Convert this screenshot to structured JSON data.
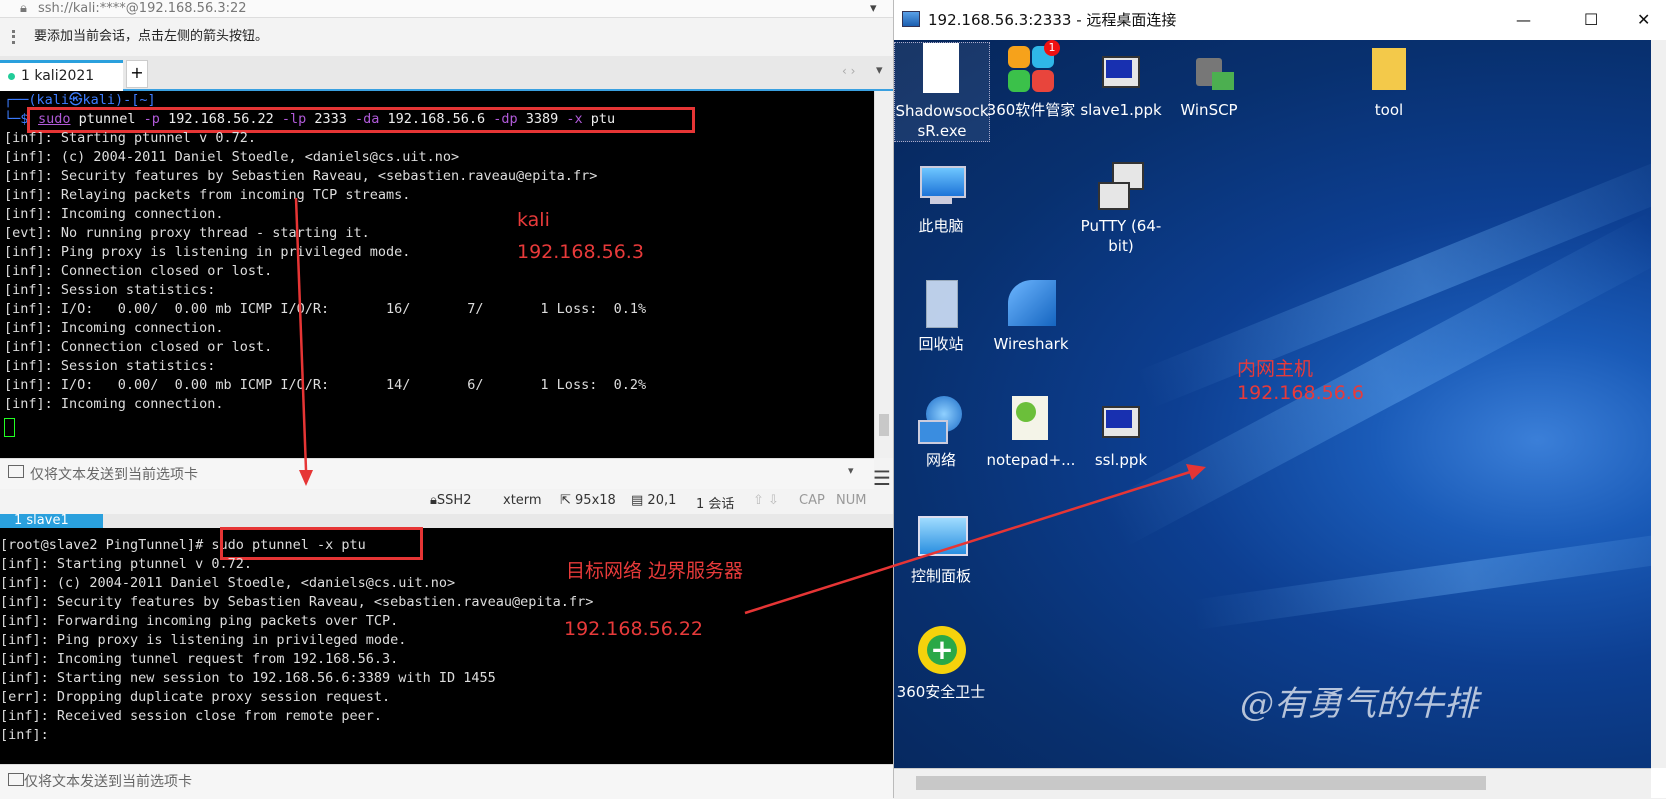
{
  "left_window": {
    "address": "ssh://kali:****@192.168.56.3:22",
    "info": "要添加当前会话，点击左侧的箭头按钮。",
    "tab_label": "1 kali2021",
    "add_tab": "+",
    "prompt_header": "┌──(kali㉿kali)-[~]",
    "prompt_sym": "└─$",
    "cmd": {
      "sudo": "sudo",
      "rest1": " ptunnel ",
      "p": "-p",
      "p_val": " 192.168.56.22 ",
      "lp": "-lp",
      "lp_val": " 2333 ",
      "da": "-da",
      "da_val": " 192.168.56.6 ",
      "dp": "-dp",
      "dp_val": " 3389 ",
      "x": "-x",
      "x_val": " ptu"
    },
    "output": [
      "[inf]: Starting ptunnel v 0.72.",
      "[inf]: (c) 2004-2011 Daniel Stoedle, <daniels@cs.uit.no>",
      "[inf]: Security features by Sebastien Raveau, <sebastien.raveau@epita.fr>",
      "[inf]: Relaying packets from incoming TCP streams.",
      "[inf]: Incoming connection.",
      "[evt]: No running proxy thread - starting it.",
      "[inf]: Ping proxy is listening in privileged mode.",
      "[inf]: Connection closed or lost.",
      "[inf]: Session statistics:",
      "[inf]: I/O:   0.00/  0.00 mb ICMP I/O/R:       16/       7/       1 Loss:  0.1%",
      "[inf]: Incoming connection.",
      "[inf]: Connection closed or lost.",
      "[inf]: Session statistics:",
      "[inf]: I/O:   0.00/  0.00 mb ICMP I/O/R:       14/       6/       1 Loss:  0.2%",
      "[inf]: Incoming connection."
    ],
    "send_bar": "仅将文本发送到当前选项卡",
    "status": {
      "ssh": "SSH2",
      "term": "xterm",
      "size": "95x18",
      "pos": "20,1",
      "sessions": "1 会话",
      "cap": "CAP",
      "num": "NUM"
    },
    "annotation_kali": "kali",
    "annotation_kali_ip": "192.168.56.3"
  },
  "bottom_window": {
    "tab_label": "1 slave1",
    "prompt": "[root@slave2 PingTunnel]#",
    "cmd": " sudo ptunnel -x ptu",
    "output": [
      "[inf]: Starting ptunnel v 0.72.",
      "[inf]: (c) 2004-2011 Daniel Stoedle, <daniels@cs.uit.no>",
      "[inf]: Security features by Sebastien Raveau, <sebastien.raveau@epita.fr>",
      "[inf]: Forwarding incoming ping packets over TCP.",
      "[inf]: Ping proxy is listening in privileged mode.",
      "[inf]: Incoming tunnel request from 192.168.56.3.",
      "[inf]: Starting new session to 192.168.56.6:3389 with ID 1455",
      "[err]: Dropping duplicate proxy session request.",
      "[inf]: Received session close from remote peer.",
      "[inf]:"
    ],
    "send_bar": "仅将文本发送到当前选项卡",
    "annotation_title": "目标网络 边界服务器",
    "annotation_ip": "192.168.56.22"
  },
  "rdp": {
    "title": "192.168.56.3:2333 - 远程桌面连接",
    "min": "—",
    "max": "☐",
    "close": "✕",
    "annotation_title": "内网主机",
    "annotation_ip": "192.168.56.6",
    "watermark": "@有勇气的牛排",
    "icons": {
      "shadowsocks": "Shadowsock sR.exe",
      "sw360": "360软件管家",
      "slave1": "slave1.ppk",
      "winscp": "WinSCP",
      "tool": "tool",
      "thispc": "此电脑",
      "putty": "PuTTY (64-bit)",
      "recycle": "回收站",
      "wireshark": "Wireshark",
      "network": "网络",
      "notepad": "notepad+...",
      "sslppk": "ssl.ppk",
      "controlpanel": "控制面板",
      "safe360": "360安全卫士"
    },
    "badge_count": "1"
  },
  "colors": {
    "annotation_red": "#e83a3a",
    "cmd_purple": "#b05ad8",
    "prompt_blue": "#3d7dff",
    "tab_accent": "#2aa0dd"
  }
}
